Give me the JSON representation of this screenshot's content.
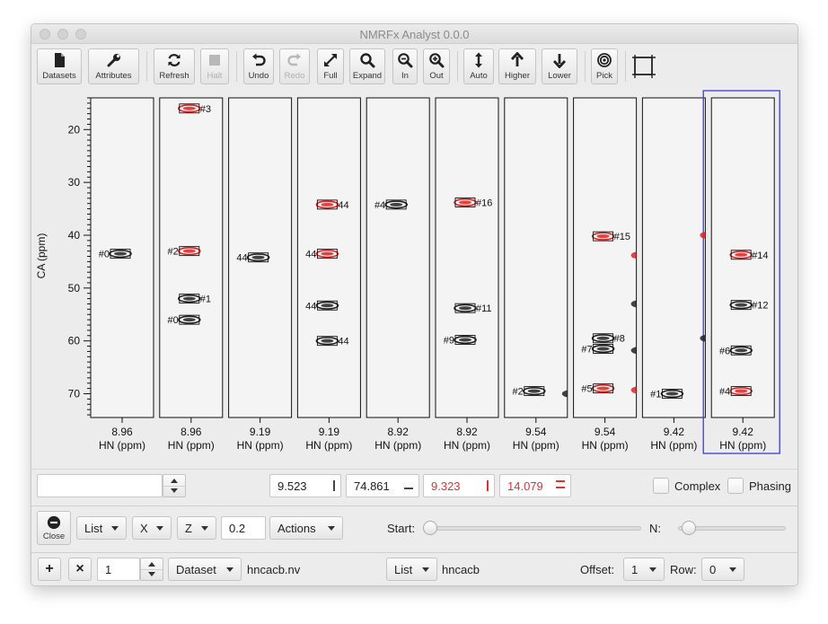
{
  "window": {
    "title": "NMRFx Analyst 0.0.0"
  },
  "toolbar": {
    "datasets": "Datasets",
    "attributes": "Attributes",
    "refresh": "Refresh",
    "halt": "Halt",
    "undo": "Undo",
    "redo": "Redo",
    "full": "Full",
    "expand": "Expand",
    "zoom_in": "In",
    "zoom_out": "Out",
    "auto": "Auto",
    "higher": "Higher",
    "lower": "Lower",
    "pick": "Pick"
  },
  "plot": {
    "y_label": "CA (ppm)",
    "x_label": "HN (ppm)",
    "y_ticks": [
      "20",
      "30",
      "40",
      "50",
      "60",
      "70"
    ],
    "y_range": [
      14,
      74.5
    ],
    "strip_x_values": [
      "8.96",
      "8.96",
      "9.19",
      "9.19",
      "8.92",
      "8.92",
      "9.54",
      "9.54",
      "9.42",
      "9.42"
    ],
    "selected_strip": 10,
    "colors": {
      "black_peak": "#222222",
      "red_peak": "#dd2222",
      "selection": "#3b3bd6"
    },
    "peaks": [
      {
        "strip": 1,
        "ca": 43.5,
        "color": "black",
        "label": "#0",
        "label_side": "left"
      },
      {
        "strip": 2,
        "ca": 16.0,
        "color": "red",
        "label": "#3",
        "label_side": "right"
      },
      {
        "strip": 2,
        "ca": 43.0,
        "color": "red",
        "label": "#2",
        "label_side": "left"
      },
      {
        "strip": 2,
        "ca": 52.0,
        "color": "black",
        "label": "#1",
        "label_side": "right"
      },
      {
        "strip": 2,
        "ca": 56.0,
        "color": "black",
        "label": "#0",
        "label_side": "left"
      },
      {
        "strip": 3,
        "ca": 44.2,
        "color": "black",
        "label": "44",
        "label_side": "left"
      },
      {
        "strip": 4,
        "ca": 34.2,
        "color": "red",
        "label": "44",
        "label_side": "right"
      },
      {
        "strip": 4,
        "ca": 43.5,
        "color": "red",
        "label": "44",
        "label_side": "left"
      },
      {
        "strip": 4,
        "ca": 53.3,
        "color": "black",
        "label": "44",
        "label_side": "left"
      },
      {
        "strip": 4,
        "ca": 60.0,
        "color": "black",
        "label": "44",
        "label_side": "right"
      },
      {
        "strip": 5,
        "ca": 34.2,
        "color": "black",
        "label": "#4",
        "label_side": "left"
      },
      {
        "strip": 6,
        "ca": 33.8,
        "color": "red",
        "label": "#16",
        "label_side": "right"
      },
      {
        "strip": 6,
        "ca": 53.8,
        "color": "black",
        "label": "#11",
        "label_side": "right"
      },
      {
        "strip": 6,
        "ca": 59.8,
        "color": "black",
        "label": "#9",
        "label_side": "left"
      },
      {
        "strip": 7,
        "ca": 69.5,
        "color": "black",
        "label": "#2",
        "label_side": "left"
      },
      {
        "strip": 8,
        "ca": 40.2,
        "color": "red",
        "label": "#15",
        "label_side": "right"
      },
      {
        "strip": 8,
        "ca": 59.5,
        "color": "black",
        "label": "#8",
        "label_side": "right"
      },
      {
        "strip": 8,
        "ca": 61.5,
        "color": "black",
        "label": "#7",
        "label_side": "left"
      },
      {
        "strip": 8,
        "ca": 69.0,
        "color": "red",
        "label": "#5",
        "label_side": "left"
      },
      {
        "strip": 9,
        "ca": 70.0,
        "color": "black",
        "label": "#1",
        "label_side": "left"
      },
      {
        "strip": 10,
        "ca": 43.7,
        "color": "red",
        "label": "#14",
        "label_side": "right"
      },
      {
        "strip": 10,
        "ca": 53.2,
        "color": "black",
        "label": "#12",
        "label_side": "right"
      },
      {
        "strip": 10,
        "ca": 61.8,
        "color": "black",
        "label": "#6",
        "label_side": "left"
      },
      {
        "strip": 10,
        "ca": 69.5,
        "color": "red",
        "label": "#4",
        "label_side": "left"
      }
    ],
    "edge_peaks": [
      {
        "strip": 7,
        "ca": 70.0,
        "color": "black"
      },
      {
        "strip": 8,
        "ca": 43.8,
        "color": "red"
      },
      {
        "strip": 8,
        "ca": 53.0,
        "color": "black"
      },
      {
        "strip": 8,
        "ca": 61.8,
        "color": "black"
      },
      {
        "strip": 8,
        "ca": 69.3,
        "color": "red"
      },
      {
        "strip": 9,
        "ca": 40.0,
        "color": "red"
      },
      {
        "strip": 9,
        "ca": 59.5,
        "color": "black"
      }
    ]
  },
  "statusbar": {
    "search_value": "",
    "coord_hn": "9.523",
    "coord_ca": "74.861",
    "delta_hn": "9.323",
    "delta_ca": "14.079",
    "complex_label": "Complex",
    "phasing_label": "Phasing"
  },
  "controls": {
    "close_label": "Close",
    "list_combo": "List",
    "x_combo": "X",
    "z_combo": "Z",
    "z_value": "0.2",
    "actions_combo": "Actions",
    "start_label": "Start:",
    "n_label": "N:"
  },
  "bottom": {
    "plus": "+",
    "times": "×",
    "index_value": "1",
    "dataset_combo": "Dataset",
    "dataset_name": "hncacb.nv",
    "list_combo": "List",
    "list_name": "hncacb",
    "offset_label": "Offset:",
    "offset_value": "1",
    "row_label": "Row:",
    "row_value": "0"
  }
}
